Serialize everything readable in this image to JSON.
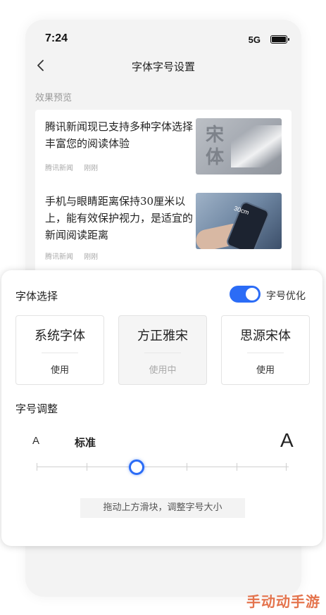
{
  "status_bar": {
    "time": "7:24",
    "network": "5G"
  },
  "nav": {
    "title": "字体字号设置"
  },
  "preview": {
    "label": "效果预览",
    "news": [
      {
        "title": "腾讯新闻现已支持多种字体选择 丰富您的阅读体验",
        "source": "腾讯新闻",
        "time": "刚刚",
        "thumb_text": "宋\n体"
      },
      {
        "title": "手机与眼睛距离保持30厘米以上，能有效保护视力，是适宜的新闻阅读距离",
        "source": "腾讯新闻",
        "time": "刚刚",
        "thumb_text": "30cm"
      }
    ]
  },
  "font_select": {
    "title": "字体选择",
    "optimize_label": "字号优化",
    "optimize_on": true,
    "options": [
      {
        "name": "系统字体",
        "action": "使用"
      },
      {
        "name": "方正雅宋",
        "action": "使用中"
      },
      {
        "name": "思源宋体",
        "action": "使用"
      }
    ]
  },
  "font_size": {
    "title": "字号调整",
    "small_label": "A",
    "current_label": "标准",
    "large_label": "A",
    "steps": 6,
    "current_step": 2,
    "hint": "拖动上方滑块，调整字号大小"
  },
  "watermark": "手动动手游",
  "colors": {
    "accent": "#2b6cf6",
    "watermark": "#e2653a"
  }
}
